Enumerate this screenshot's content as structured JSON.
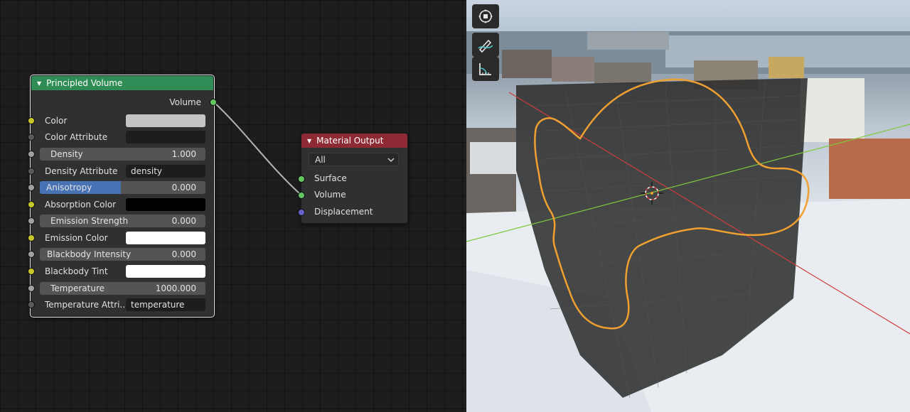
{
  "nodes": {
    "principled_volume": {
      "title": "Principled Volume",
      "output_volume": "Volume",
      "rows": [
        {
          "label": "Color",
          "color": "#c4c4c4"
        },
        {
          "label": "Color Attribute",
          "value": ""
        },
        {
          "label": "Density",
          "value": "1.000"
        },
        {
          "label": "Density Attribute",
          "value": "density"
        },
        {
          "label": "Anisotropy",
          "value": "0.000"
        },
        {
          "label": "Absorption Color",
          "color": "#000000"
        },
        {
          "label": "Emission Strength",
          "value": "0.000"
        },
        {
          "label": "Emission Color",
          "color": "#ffffff"
        },
        {
          "label": "Blackbody Intensity",
          "value": "0.000"
        },
        {
          "label": "Blackbody Tint",
          "color": "#ffffff"
        },
        {
          "label": "Temperature",
          "value": "1000.000"
        },
        {
          "label": "Temperature Attri..",
          "value": "temperature"
        }
      ]
    },
    "material_output": {
      "title": "Material Output",
      "target": "All",
      "inputs": [
        "Surface",
        "Volume",
        "Displacement"
      ]
    }
  },
  "colors": {
    "header_green": "#2f8c55",
    "header_red": "#8e2a34",
    "socket_yellow": "#c7c729",
    "socket_grey": "#a1a1a1",
    "socket_dark": "#5a5a5a",
    "socket_green": "#63c763",
    "socket_violet": "#6363c7",
    "slider_blue": "#4772b3",
    "selection_orange": "#f0a030",
    "axis_x": "#d23c3c",
    "axis_y": "#7ec83c"
  },
  "viewport": {
    "tools": [
      "view-navigate-icon",
      "annotate-icon",
      "measure-icon"
    ]
  }
}
